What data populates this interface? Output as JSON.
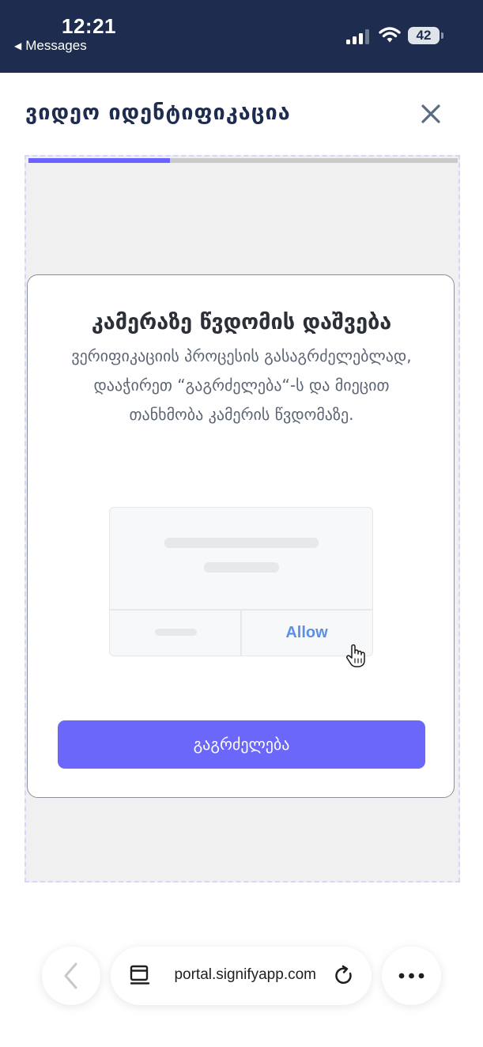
{
  "status_bar": {
    "time": "12:21",
    "back_app": "Messages",
    "battery": "42",
    "background": "#1e2d4f"
  },
  "header": {
    "title": "ვიდეო იდენტიფიკაცია",
    "close_icon": "close-x"
  },
  "progress": {
    "value": 0.33,
    "accent": "#6b63ff"
  },
  "modal": {
    "title": "კამერაზე წვდომის დაშვება",
    "description": "ვერიფიკაციის პროცესის გასაგრძელებლად, დააჭირეთ “გაგრძელება“-ს და მიეცით თანხმობა კამერის წვდომაზე.",
    "illustration": {
      "allow_label": "Allow",
      "cursor_icon": "hand-pointer"
    },
    "continue_label": "გაგრძელება",
    "continue_color": "#6b67fb"
  },
  "browser_bar": {
    "url": "portal.signifyapp.com",
    "icons": [
      "back-arrow",
      "tab-layout",
      "reload",
      "more-dots"
    ]
  }
}
